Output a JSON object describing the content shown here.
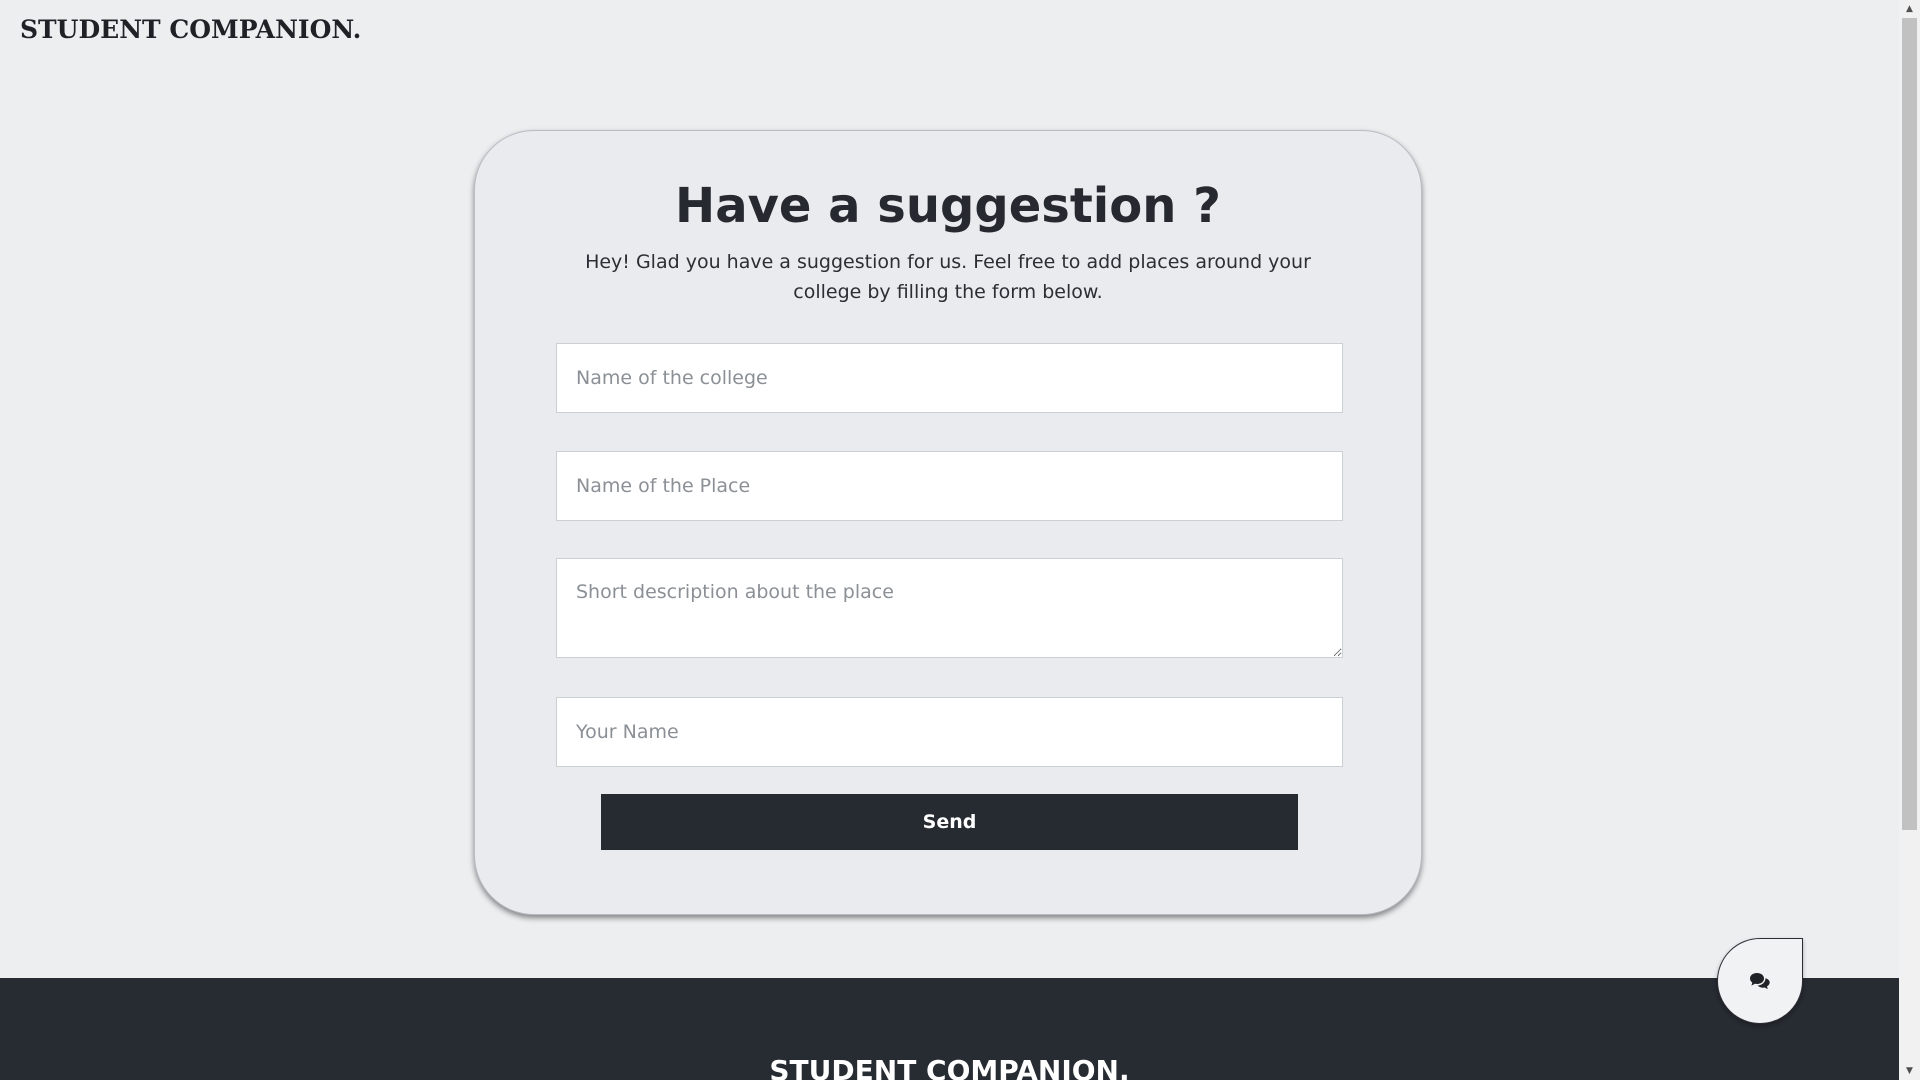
{
  "header": {
    "brand": "STUDENT COMPANION."
  },
  "form": {
    "title": "Have a suggestion ?",
    "description": "Hey! Glad you have a suggestion for us. Feel free to add places around your college by filling the form below.",
    "college_placeholder": "Name of the college",
    "place_placeholder": "Name of the Place",
    "description_placeholder": "Short description about the place",
    "name_placeholder": "Your Name",
    "send_label": "Send"
  },
  "footer": {
    "brand": "STUDENT COMPANION."
  },
  "chat": {
    "icon": "chat-bubbles-icon"
  },
  "colors": {
    "background": "#edeef0",
    "card": "#e9ebee",
    "dark": "#262a31",
    "footer": "#272b32"
  }
}
